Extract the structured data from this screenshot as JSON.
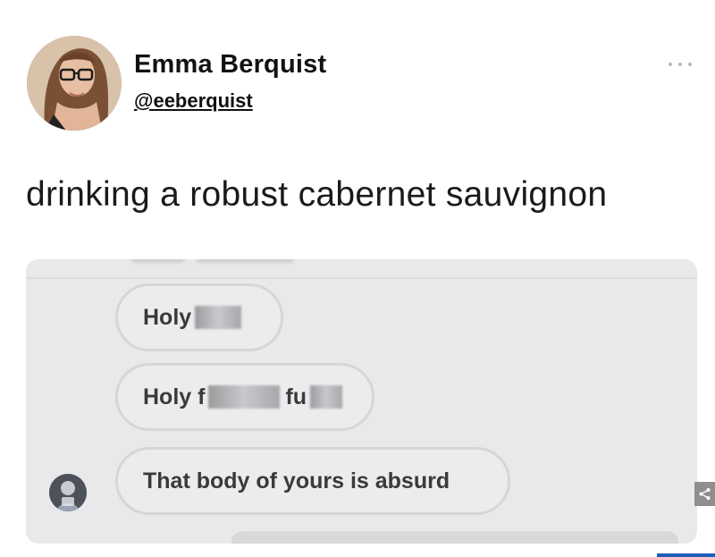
{
  "tweet": {
    "display_name": "Emma Berquist",
    "handle": "@eeberquist",
    "text": "drinking a robust cabernet sauvignon",
    "more_icon": "more-horizontal-icon"
  },
  "screenshot_media": {
    "messages": [
      {
        "visible_text": "Holy",
        "censored": true
      },
      {
        "visible_text": "Holy f",
        "censored": true,
        "second_word_visible": "fu"
      },
      {
        "visible_text": "That body of yours is absurd",
        "censored": false
      }
    ],
    "sender_avatar_icon": "avatar-icon"
  },
  "overlay": {
    "share_icon": "share-icon"
  },
  "colors": {
    "text": "#111111",
    "media_bg": "#e9e9eb",
    "bubble_border": "#d6d6d9",
    "accent": "#1c5fb8"
  }
}
